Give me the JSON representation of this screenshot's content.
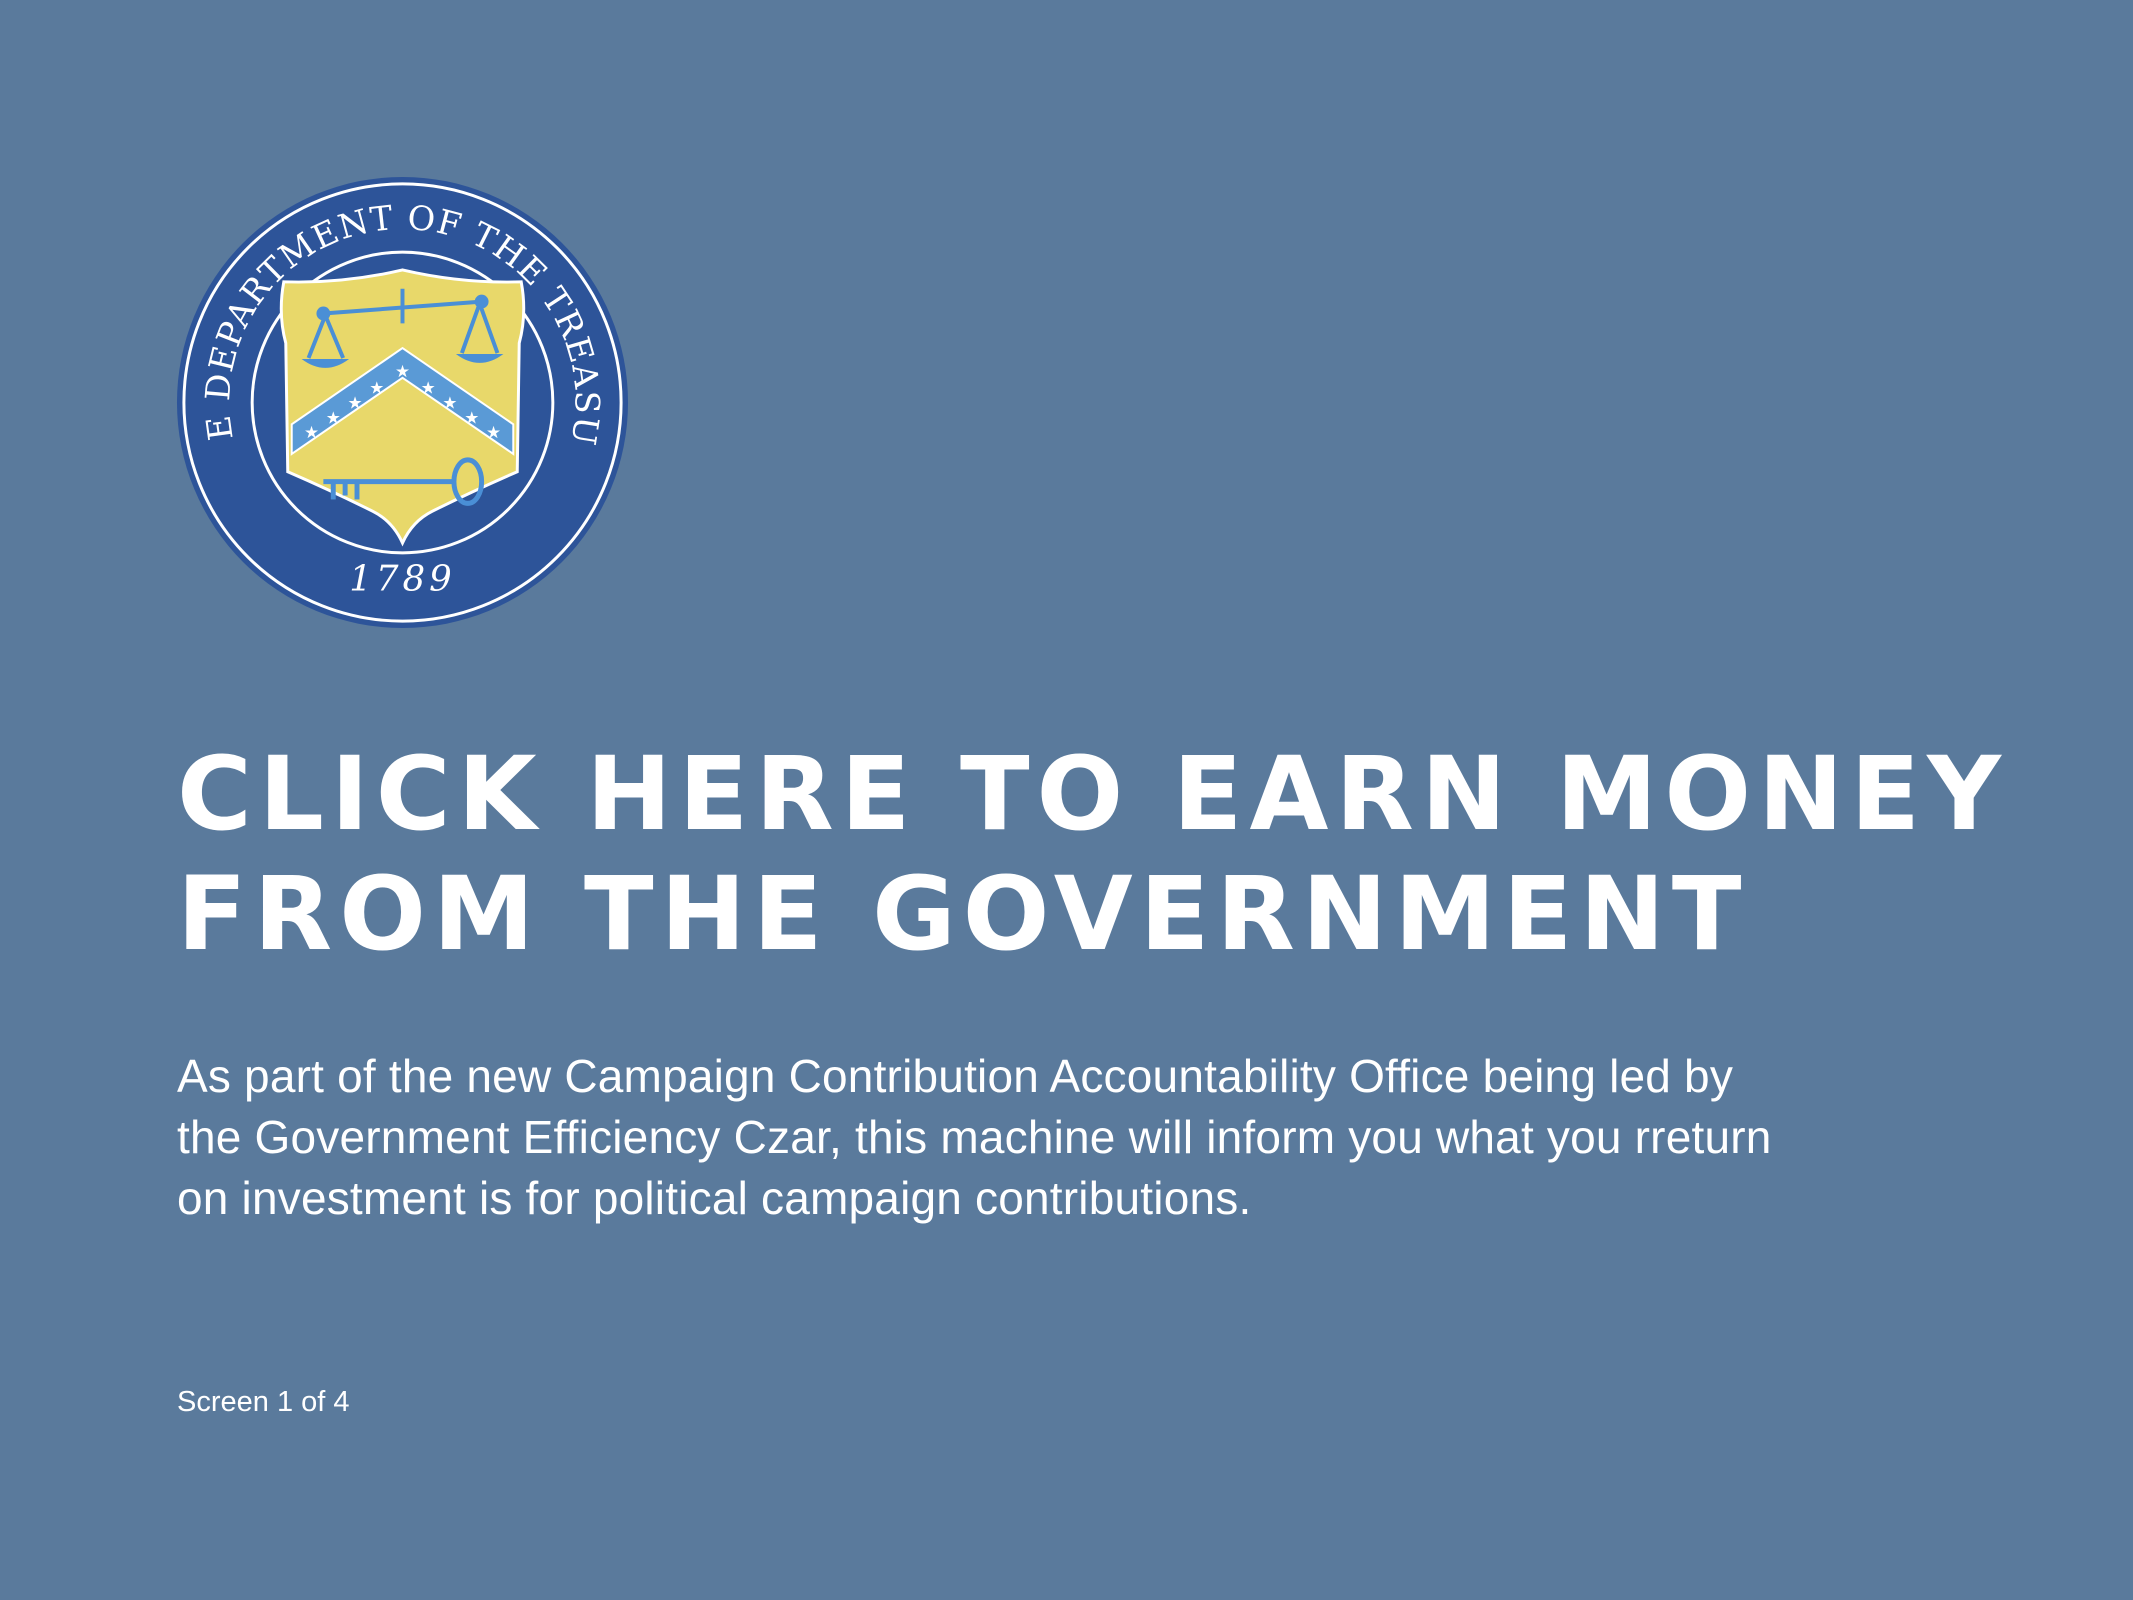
{
  "seal": {
    "arc_text": "THE DEPARTMENT OF THE TREASURY",
    "year": "1789",
    "colors": {
      "ring": "#2d5499",
      "shield": "#e8d86a",
      "chevron": "#5a9ad6",
      "instruments": "#4a8fd6"
    }
  },
  "headline": {
    "line1": "CLICK HERE TO EARN MONEY",
    "line2": "FROM THE GOVERNMENT"
  },
  "body": {
    "line1": "As part of the new Campaign Contribution Accountability Office being led by",
    "line2": "the Government Efficiency Czar, this machine will inform you what you rreturn",
    "line3": "on investment is for political campaign contributions."
  },
  "footer": {
    "screen_indicator": "Screen 1 of 4"
  },
  "colors": {
    "background": "#5a7a9c",
    "text": "#ffffff"
  }
}
